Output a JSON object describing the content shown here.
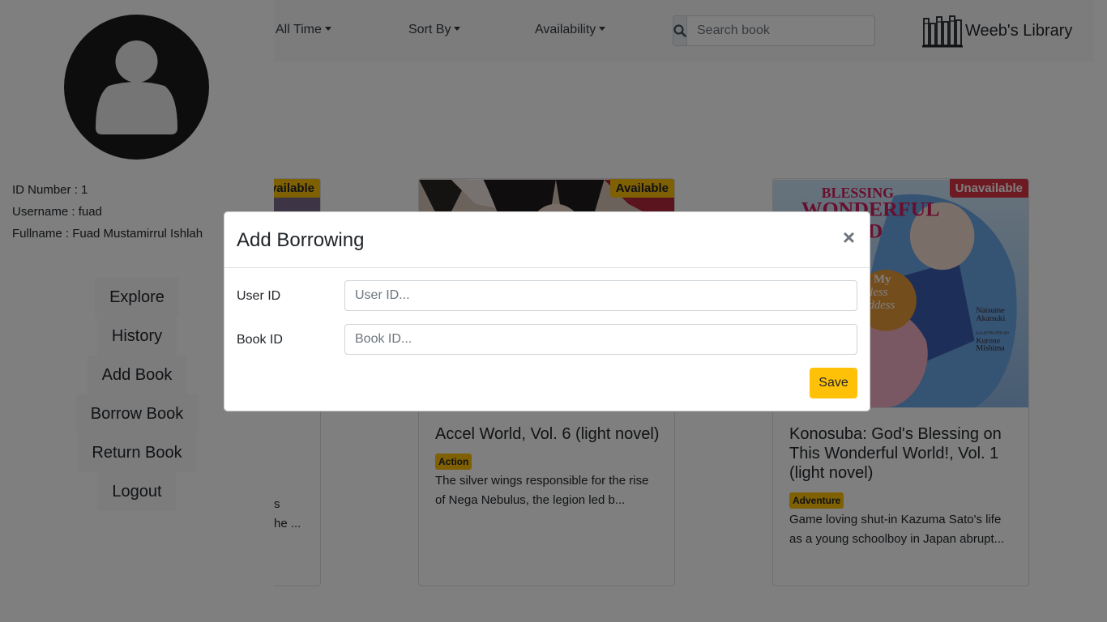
{
  "navbar": {
    "period_dropdown": "All Time",
    "sort_dropdown": "Sort By",
    "availability_dropdown": "Availability",
    "search_placeholder": "Search book",
    "brand_name": "Weeb's Library"
  },
  "cards": [
    {
      "status": "Available",
      "title": "",
      "genre": "",
      "description_fragment_1": "s",
      "description_fragment_2": "he ..."
    },
    {
      "status": "Available",
      "title": "Accel World, Vol. 6 (light novel)",
      "genre": "Action",
      "description": "The silver wings responsible for the rise of Nega Nebulus, the legion led b..."
    },
    {
      "status": "Unavailable",
      "title": "Konosuba: God's Blessing on This Wonderful World!, Vol. 1 (light novel)",
      "genre": "Adventure",
      "description": "Game loving shut-in Kazuma Sato's life as a young schoolboy in Japan abrupt...",
      "cover_text": {
        "line1": "BLESSING",
        "line2": "WONDERFUL",
        "line3": "WORLD",
        "author_first": "Natsume",
        "author_last": "Akatsuki",
        "illustrated_by": "ILLUSTRATED BY",
        "illustrator_first": "Kurone",
        "illustrator_last": "Mishima",
        "tagline_1": "! My",
        "tagline_2": "less",
        "tagline_3": "ddess"
      }
    }
  ],
  "sidebar": {
    "id_number": "ID Number : 1",
    "username": "Username : fuad",
    "fullname": "Fullname : Fuad Mustamirrul Ishlah",
    "menu": [
      "Explore",
      "History",
      "Add Book",
      "Borrow Book",
      "Return Book",
      "Logout"
    ]
  },
  "modal": {
    "title": "Add Borrowing",
    "close_symbol": "×",
    "user_id_label": "User ID",
    "user_id_placeholder": "User ID...",
    "user_id_value": "",
    "book_id_label": "Book ID",
    "book_id_placeholder": "Book ID...",
    "book_id_value": "",
    "save_label": "Save"
  },
  "colors": {
    "accent": "#ffc107",
    "danger": "#dc3545",
    "overlay": "rgba(0,0,0,0.5)"
  }
}
